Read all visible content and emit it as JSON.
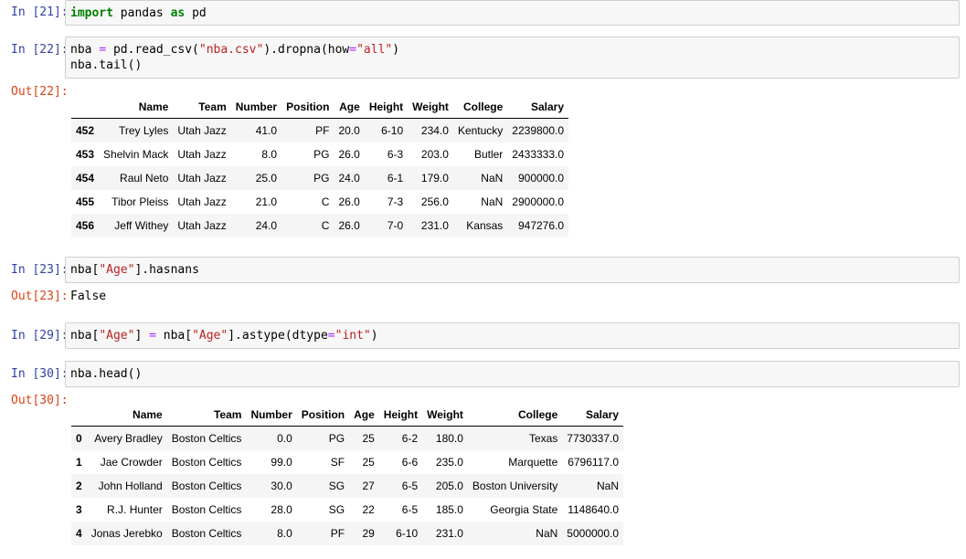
{
  "cells": {
    "c21": {
      "in_prompt": "In [21]:",
      "code": [
        {
          "t": "import",
          "c": "kw"
        },
        {
          "t": " pandas ",
          "c": ""
        },
        {
          "t": "as",
          "c": "kw"
        },
        {
          "t": " pd",
          "c": ""
        }
      ]
    },
    "c22": {
      "in_prompt": "In [22]:",
      "line1": [
        {
          "t": "nba ",
          "c": ""
        },
        {
          "t": "=",
          "c": "op"
        },
        {
          "t": " pd.read_csv(",
          "c": ""
        },
        {
          "t": "\"nba.csv\"",
          "c": "str"
        },
        {
          "t": ").dropna(how",
          "c": ""
        },
        {
          "t": "=",
          "c": "op"
        },
        {
          "t": "\"all\"",
          "c": "str"
        },
        {
          "t": ")",
          "c": ""
        }
      ],
      "line2": "nba.tail()",
      "out_prompt": "Out[22]:",
      "table": {
        "columns": [
          "",
          "Name",
          "Team",
          "Number",
          "Position",
          "Age",
          "Height",
          "Weight",
          "College",
          "Salary"
        ],
        "rows": [
          [
            "452",
            "Trey Lyles",
            "Utah Jazz",
            "41.0",
            "PF",
            "20.0",
            "6-10",
            "234.0",
            "Kentucky",
            "2239800.0"
          ],
          [
            "453",
            "Shelvin Mack",
            "Utah Jazz",
            "8.0",
            "PG",
            "26.0",
            "6-3",
            "203.0",
            "Butler",
            "2433333.0"
          ],
          [
            "454",
            "Raul Neto",
            "Utah Jazz",
            "25.0",
            "PG",
            "24.0",
            "6-1",
            "179.0",
            "NaN",
            "900000.0"
          ],
          [
            "455",
            "Tibor Pleiss",
            "Utah Jazz",
            "21.0",
            "C",
            "26.0",
            "7-3",
            "256.0",
            "NaN",
            "2900000.0"
          ],
          [
            "456",
            "Jeff Withey",
            "Utah Jazz",
            "24.0",
            "C",
            "26.0",
            "7-0",
            "231.0",
            "Kansas",
            "947276.0"
          ]
        ]
      }
    },
    "c23": {
      "in_prompt": "In [23]:",
      "code": [
        {
          "t": "nba[",
          "c": ""
        },
        {
          "t": "\"Age\"",
          "c": "str"
        },
        {
          "t": "].hasnans",
          "c": ""
        }
      ],
      "out_prompt": "Out[23]:",
      "output": "False"
    },
    "c29": {
      "in_prompt": "In [29]:",
      "code": [
        {
          "t": "nba[",
          "c": ""
        },
        {
          "t": "\"Age\"",
          "c": "str"
        },
        {
          "t": "] ",
          "c": ""
        },
        {
          "t": "=",
          "c": "op"
        },
        {
          "t": " nba[",
          "c": ""
        },
        {
          "t": "\"Age\"",
          "c": "str"
        },
        {
          "t": "].astype(dtype",
          "c": ""
        },
        {
          "t": "=",
          "c": "op"
        },
        {
          "t": "\"int\"",
          "c": "str"
        },
        {
          "t": ")",
          "c": ""
        }
      ]
    },
    "c30": {
      "in_prompt": "In [30]:",
      "code": [
        {
          "t": "nba.head()",
          "c": ""
        }
      ],
      "out_prompt": "Out[30]:",
      "table": {
        "columns": [
          "",
          "Name",
          "Team",
          "Number",
          "Position",
          "Age",
          "Height",
          "Weight",
          "College",
          "Salary"
        ],
        "rows": [
          [
            "0",
            "Avery Bradley",
            "Boston Celtics",
            "0.0",
            "PG",
            "25",
            "6-2",
            "180.0",
            "Texas",
            "7730337.0"
          ],
          [
            "1",
            "Jae Crowder",
            "Boston Celtics",
            "99.0",
            "SF",
            "25",
            "6-6",
            "235.0",
            "Marquette",
            "6796117.0"
          ],
          [
            "2",
            "John Holland",
            "Boston Celtics",
            "30.0",
            "SG",
            "27",
            "6-5",
            "205.0",
            "Boston University",
            "NaN"
          ],
          [
            "3",
            "R.J. Hunter",
            "Boston Celtics",
            "28.0",
            "SG",
            "22",
            "6-5",
            "185.0",
            "Georgia State",
            "1148640.0"
          ],
          [
            "4",
            "Jonas Jerebko",
            "Boston Celtics",
            "8.0",
            "PF",
            "29",
            "6-10",
            "231.0",
            "NaN",
            "5000000.0"
          ]
        ]
      }
    }
  }
}
